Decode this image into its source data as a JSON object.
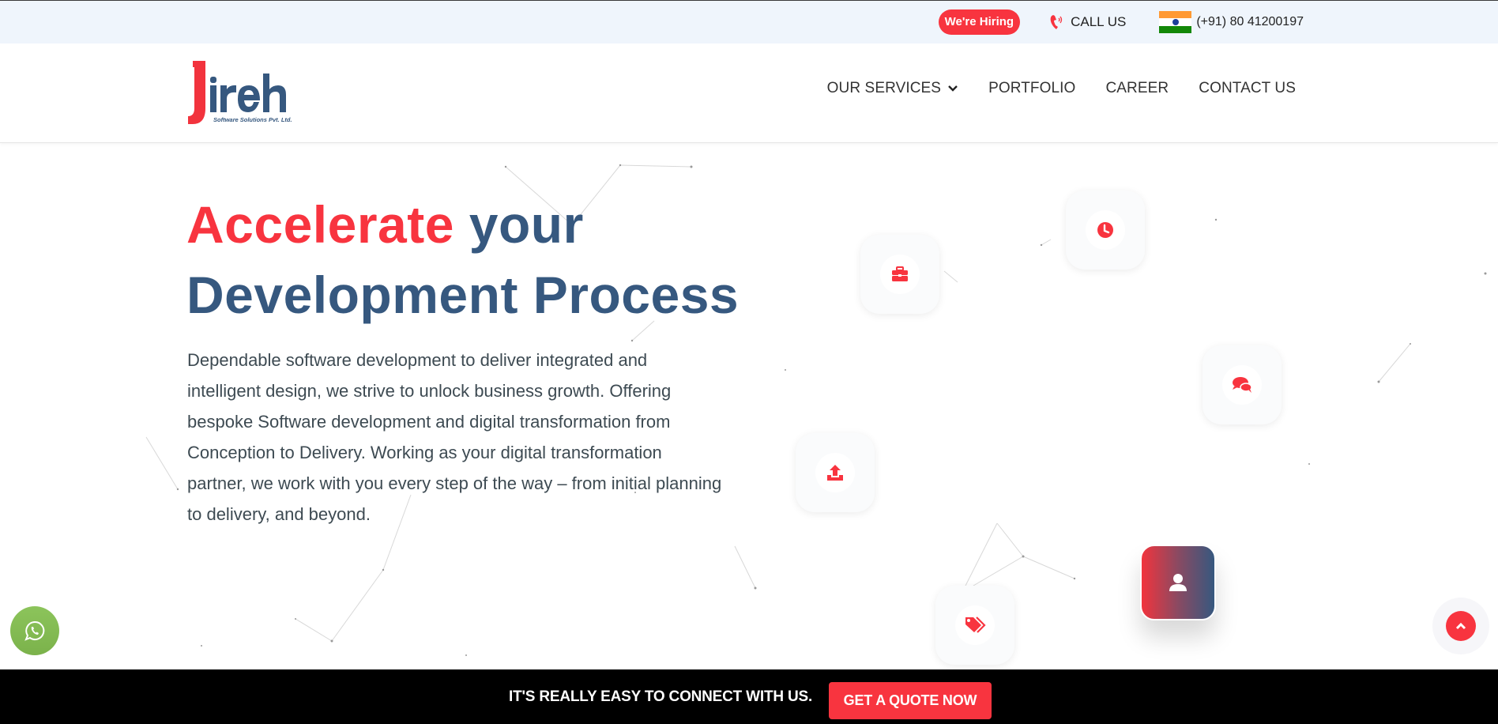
{
  "topbar": {
    "hiring_label": "We're Hiring",
    "call_label": "CALL US",
    "phone_number": "(+91) 80 41200197",
    "flag": "india-flag"
  },
  "header": {
    "logo": {
      "main_text": "Jireh",
      "subtitle": "Software Solutions Pvt. Ltd."
    },
    "nav": [
      {
        "label": "OUR SERVICES",
        "has_dropdown": true
      },
      {
        "label": "PORTFOLIO"
      },
      {
        "label": "CAREER"
      },
      {
        "label": "CONTACT US"
      }
    ]
  },
  "hero": {
    "title_accent": "Accelerate",
    "title_line1_rest": " your",
    "title_line2": "Development Process",
    "description": "Dependable software development to deliver integrated and intelligent design, we strive to unlock business growth. Offering bespoke Software development and digital transformation from Conception to Delivery. Working as your digital transformation partner, we work with you every step of the way – from initial planning to delivery, and beyond."
  },
  "feature_icons": [
    {
      "icon": "briefcase-icon"
    },
    {
      "icon": "clock-icon"
    },
    {
      "icon": "chat-icon"
    },
    {
      "icon": "upload-icon"
    },
    {
      "icon": "tags-icon"
    },
    {
      "icon": "user-icon"
    }
  ],
  "floating": {
    "whatsapp_icon": "whatsapp-icon",
    "scroll_top_icon": "chevron-up-icon"
  },
  "bottombar": {
    "text": "IT'S REALLY EASY TO CONNECT WITH US.",
    "button_label": "GET A QUOTE NOW"
  },
  "colors": {
    "accent_red": "#f8343f",
    "brand_blue": "#36587f",
    "topbar_bg": "#eff5fc",
    "whatsapp_green": "#8cc45b",
    "bottombar_bg": "#000000"
  }
}
